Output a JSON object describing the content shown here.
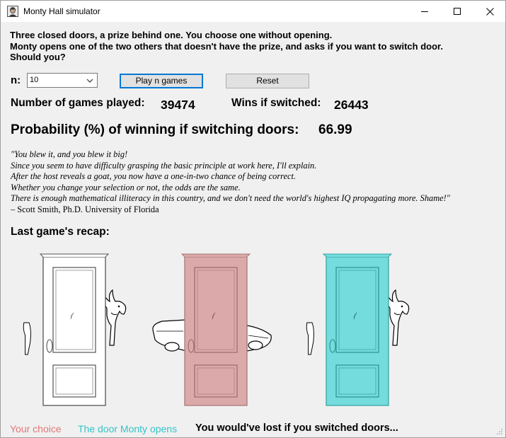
{
  "window": {
    "title": "Monty Hall simulator",
    "icon": "portrait-icon",
    "controls": [
      "minimize-icon",
      "maximize-icon",
      "close-icon"
    ]
  },
  "intro": {
    "line1": "Three closed doors, a prize behind one. You choose one without opening.",
    "line2": "Monty opens one of the two others that doesn't have the prize, and asks if you want to switch door.",
    "line3": "Should you?"
  },
  "controls": {
    "n_label": "n:",
    "n_value": "10",
    "play_button": "Play n games",
    "reset_button": "Reset"
  },
  "stats": {
    "games_played_label": "Number of games played:",
    "games_played_value": "39474",
    "wins_switched_label": "Wins if switched:",
    "wins_switched_value": "26443",
    "probability_label": "Probability (%) of winning if switching doors:",
    "probability_value": "66.99"
  },
  "quote": {
    "lines": [
      "\"You blew it, and you blew it big!",
      "Since you seem to have difficulty grasping the basic principle at work here, I'll explain.",
      "After the host reveals a goat, you now have a one-in-two chance of being correct.",
      "Whether you change your selection or not, the odds are the same.",
      "There is enough mathematical illiteracy in this country, and we don't need the world's highest IQ propagating more. Shame!\""
    ],
    "author": " – Scott Smith, Ph.D. University of Florida"
  },
  "recap": {
    "title": "Last game's recap:",
    "doors": [
      {
        "behind": "goat",
        "state": "neutral",
        "color": "#ffffff"
      },
      {
        "behind": "car",
        "state": "your-choice",
        "color": "#dba9a9"
      },
      {
        "behind": "goat",
        "state": "monty-opens",
        "color": "#74dcdc"
      }
    ]
  },
  "legend": {
    "your_choice": "Your choice",
    "your_choice_color": "#e07878",
    "monty_opens": "The door Monty opens",
    "monty_opens_color": "#35c3c8",
    "result": "You would've lost if you switched doors..."
  }
}
